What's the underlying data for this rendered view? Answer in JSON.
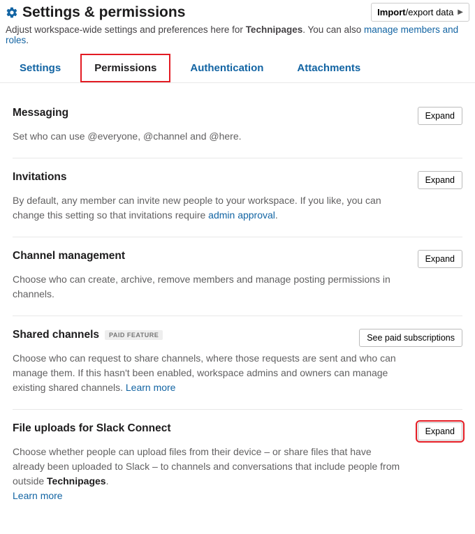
{
  "header": {
    "title": "Settings & permissions",
    "import_label_prefix": "Import",
    "import_label_mid": "/",
    "import_label_suffix": "export data"
  },
  "subtitle": {
    "prefix": "Adjust workspace-wide settings and preferences here for ",
    "workspace": "Technipages",
    "mid": ". You can also ",
    "link": "manage members and roles",
    "suffix": "."
  },
  "tabs": {
    "settings": "Settings",
    "permissions": "Permissions",
    "authentication": "Authentication",
    "attachments": "Attachments"
  },
  "sections": {
    "messaging": {
      "title": "Messaging",
      "desc": "Set who can use @everyone, @channel and @here.",
      "btn": "Expand"
    },
    "invitations": {
      "title": "Invitations",
      "desc_pre": "By default, any member can invite new people to your workspace. If you like, you can change this setting so that invitations require ",
      "link": "admin approval",
      "desc_post": ".",
      "btn": "Expand"
    },
    "channel": {
      "title": "Channel management",
      "desc": "Choose who can create, archive, remove members and manage posting permissions in channels.",
      "btn": "Expand"
    },
    "shared": {
      "title": "Shared channels",
      "badge": "PAID FEATURE",
      "desc_pre": "Choose who can request to share channels, where those requests are sent and who can manage them. If this hasn't been enabled, workspace admins and owners can manage existing shared channels. ",
      "link": "Learn more",
      "btn": "See paid subscriptions"
    },
    "file": {
      "title": "File uploads for Slack Connect",
      "desc_pre": "Choose whether people can upload files from their device – or share files that have already been uploaded to Slack – to channels and conversations that include people from outside ",
      "ws": "Technipages",
      "desc_post": ". ",
      "link": "Learn more",
      "btn": "Expand"
    }
  }
}
